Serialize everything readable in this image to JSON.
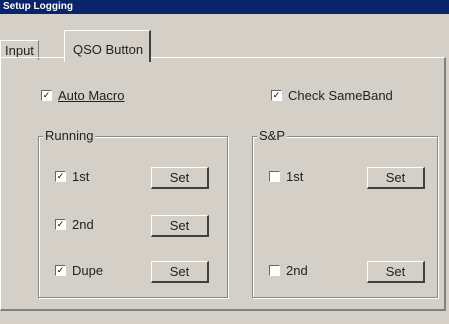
{
  "window": {
    "title": "Setup Logging"
  },
  "tabs": [
    {
      "label": "Input",
      "active": false
    },
    {
      "label": "QSO Button",
      "active": true
    }
  ],
  "options": {
    "auto_macro": {
      "label": "Auto Macro",
      "checked": true
    },
    "check_sameband": {
      "label": "Check SameBand",
      "checked": true
    }
  },
  "running": {
    "title": "Running",
    "items": [
      {
        "label": "1st",
        "checked": true,
        "button": "Set"
      },
      {
        "label": "2nd",
        "checked": true,
        "button": "Set"
      },
      {
        "label": "Dupe",
        "checked": true,
        "button": "Set"
      }
    ]
  },
  "sp": {
    "title": "S&P",
    "items": [
      {
        "label": "1st",
        "checked": false,
        "button": "Set"
      },
      {
        "label": "2nd",
        "checked": false,
        "button": "Set"
      }
    ]
  },
  "check_glyph": "✓"
}
